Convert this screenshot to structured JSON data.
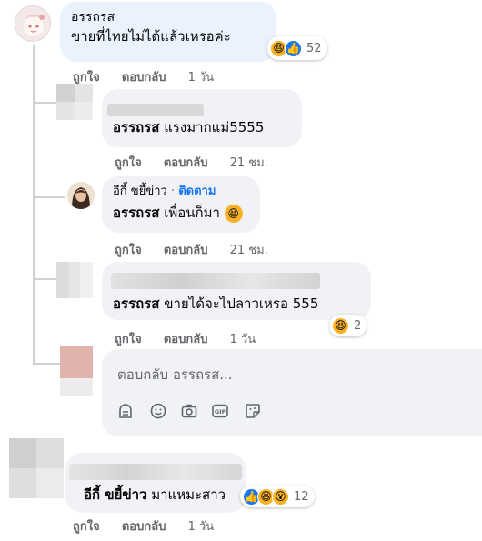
{
  "comments": [
    {
      "author": "อรรถรส",
      "text": "ขายที่ไทยไม่ได้แล้วเหรอค่ะ",
      "like_label": "ถูกใจ",
      "reply_label": "ตอบกลับ",
      "time": "1 วัน",
      "reaction_count": "52",
      "reactions": [
        "haha",
        "like"
      ]
    },
    {
      "author_blurred": true,
      "mention": "อรรถรส",
      "text": "แรงมากแม่5555",
      "like_label": "ถูกใจ",
      "reply_label": "ตอบกลับ",
      "time": "21 ชม."
    },
    {
      "author": "อีกี้ ขยี้ข่าว",
      "follow_label": "ติดตาม",
      "mention": "อรรถรส",
      "text": "เพื่อนก็มา",
      "like_label": "ถูกใจ",
      "reply_label": "ตอบกลับ",
      "time": "21 ชม.",
      "reactions": [
        "haha"
      ]
    },
    {
      "author_blurred": true,
      "mention": "อรรถรส",
      "text": "ขายได้จะไปลาวเหรอ 555",
      "like_label": "ถูกใจ",
      "reply_label": "ตอบกลับ",
      "time": "1 วัน",
      "reaction_count": "2",
      "reactions": [
        "haha"
      ]
    },
    {
      "author_blurred": true,
      "mention": "อีกี้ ขยี้ข่าว",
      "text": "มาแหมะสาว",
      "like_label": "ถูกใจ",
      "reply_label": "ตอบกลับ",
      "time": "1 วัน",
      "reaction_count": "12",
      "reactions": [
        "like",
        "haha",
        "wow"
      ]
    }
  ],
  "reply_box": {
    "placeholder": "ตอบกลับ อรรถรส...",
    "tools": [
      "avatar-sticker-icon",
      "emoji-icon",
      "camera-icon",
      "gif-icon",
      "sticker-icon"
    ]
  },
  "separator": "·",
  "colors": {
    "bubble": "#f0f2f5",
    "bubble_highlight": "#eaf2fd",
    "link_blue": "#1877f2",
    "meta_gray": "#65676b",
    "haha_yellow": "#f7b125",
    "like_blue": "#1877f2"
  }
}
